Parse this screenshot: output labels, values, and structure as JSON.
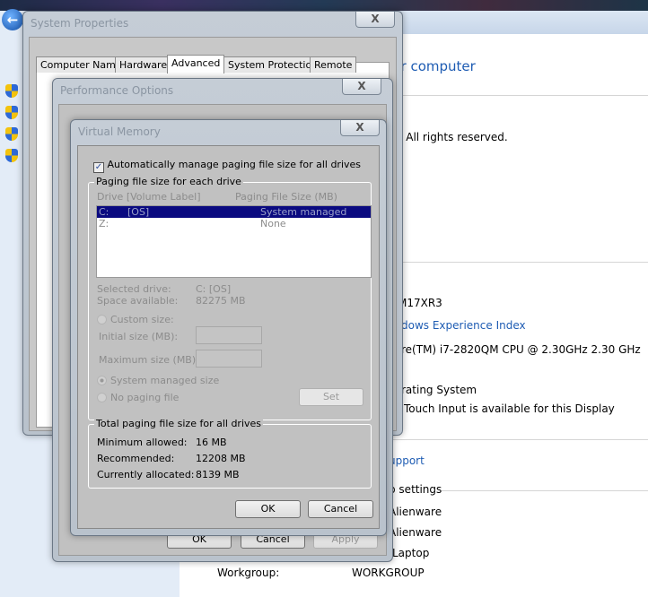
{
  "background": {
    "title_fragment": "ur computer",
    "copyright_fragment": "n.  All rights reserved.",
    "model_fragment": "M17XR3",
    "wei_link_fragment": "dows Experience Index",
    "cpu_fragment": "re(TM) i7-2820QM CPU @ 2.30GHz   2.30 GHz",
    "os_fragment": "rating System",
    "touch_fragment": "Touch Input is available for this Display",
    "support_fragment": "upport",
    "settings_fragment": "p settings",
    "computer_name_fragment": "Alienware",
    "full_name_fragment": "Alienware",
    "description_fragment": "Laptop",
    "workgroup_label": "Workgroup:",
    "workgroup_value": "WORKGROUP"
  },
  "system_properties": {
    "title": "System Properties",
    "close": "X",
    "tabs": [
      {
        "label": "Computer Name"
      },
      {
        "label": "Hardware"
      },
      {
        "label": "Advanced",
        "selected": true
      },
      {
        "label": "System Protection"
      },
      {
        "label": "Remote"
      }
    ]
  },
  "performance_options": {
    "title": "Performance Options",
    "close": "X",
    "ok": "OK",
    "cancel": "Cancel",
    "apply": "Apply"
  },
  "virtual_memory": {
    "title": "Virtual Memory",
    "close": "X",
    "auto_manage_label": "Automatically manage paging file size for all drives",
    "auto_manage_checked": true,
    "group_each_drive": "Paging file size for each drive",
    "col_drive": "Drive  [Volume Label]",
    "col_size": "Paging File Size (MB)",
    "drives": [
      {
        "drive": "C:",
        "label": "[OS]",
        "size": "System managed",
        "selected": true
      },
      {
        "drive": "Z:",
        "label": "",
        "size": "None",
        "selected": false
      }
    ],
    "selected_drive_label": "Selected drive:",
    "selected_drive_value": "C:  [OS]",
    "space_available_label": "Space available:",
    "space_available_value": "82275 MB",
    "custom_size": "Custom size:",
    "initial_size": "Initial size (MB):",
    "maximum_size": "Maximum size (MB):",
    "system_managed": "System managed size",
    "no_paging": "No paging file",
    "set": "Set",
    "group_total": "Total paging file size for all drives",
    "min_label": "Minimum allowed:",
    "min_value": "16 MB",
    "rec_label": "Recommended:",
    "rec_value": "12208 MB",
    "cur_label": "Currently allocated:",
    "cur_value": "8139 MB",
    "ok": "OK",
    "cancel": "Cancel"
  },
  "colors": {
    "selection": "#0a0a80",
    "link": "#1e5cb3",
    "dialog_face": "#c1c1c1"
  }
}
